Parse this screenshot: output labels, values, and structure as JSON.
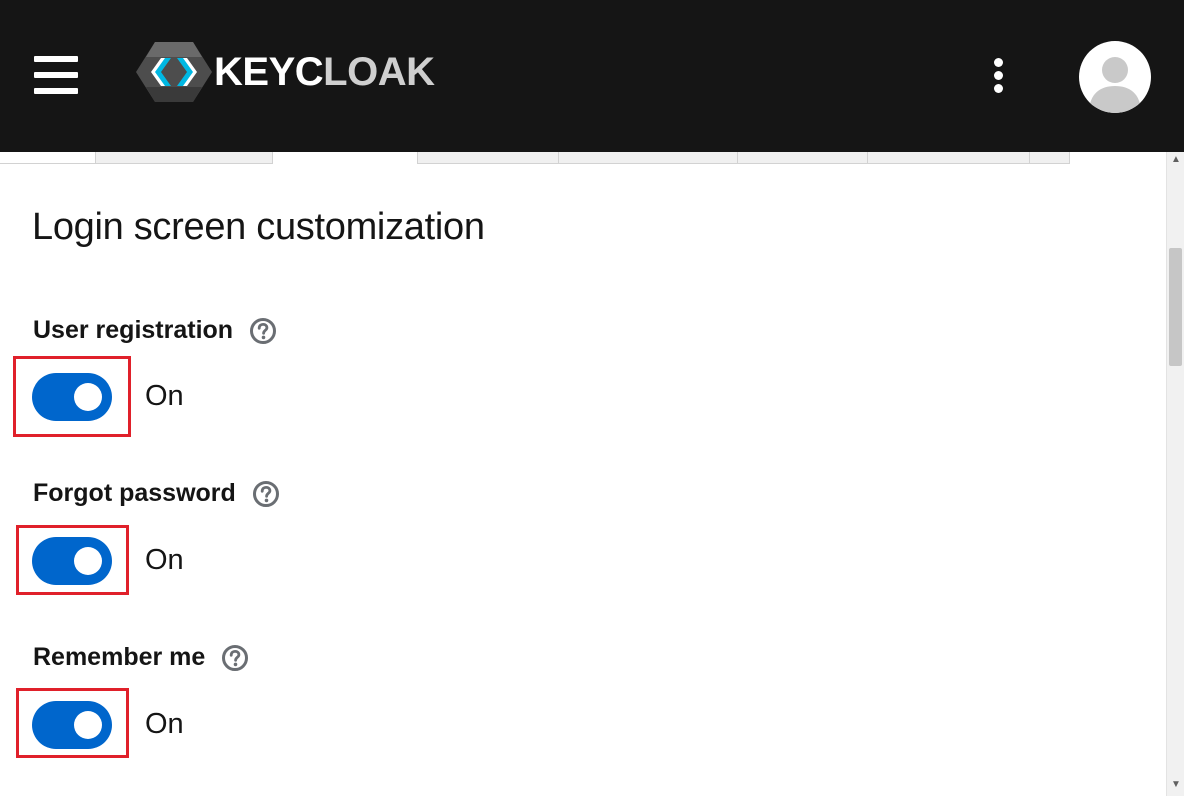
{
  "header": {
    "menu_icon": "hamburger-menu-icon",
    "logo_text_part1": "KEYC",
    "logo_text_part2": "LOAK",
    "kebab_icon": "kebab-menu-icon",
    "avatar_icon": "user-avatar-icon"
  },
  "section": {
    "title": "Login screen customization"
  },
  "settings": [
    {
      "label": "User registration",
      "state": "On",
      "enabled": true,
      "help_icon": "help-circle-icon"
    },
    {
      "label": "Forgot password",
      "state": "On",
      "enabled": true,
      "help_icon": "help-circle-icon"
    },
    {
      "label": "Remember me",
      "state": "On",
      "enabled": true,
      "help_icon": "help-circle-icon"
    }
  ],
  "colors": {
    "masthead": "#151515",
    "switch_on": "#0066cc",
    "highlight_box": "#e0202a"
  }
}
